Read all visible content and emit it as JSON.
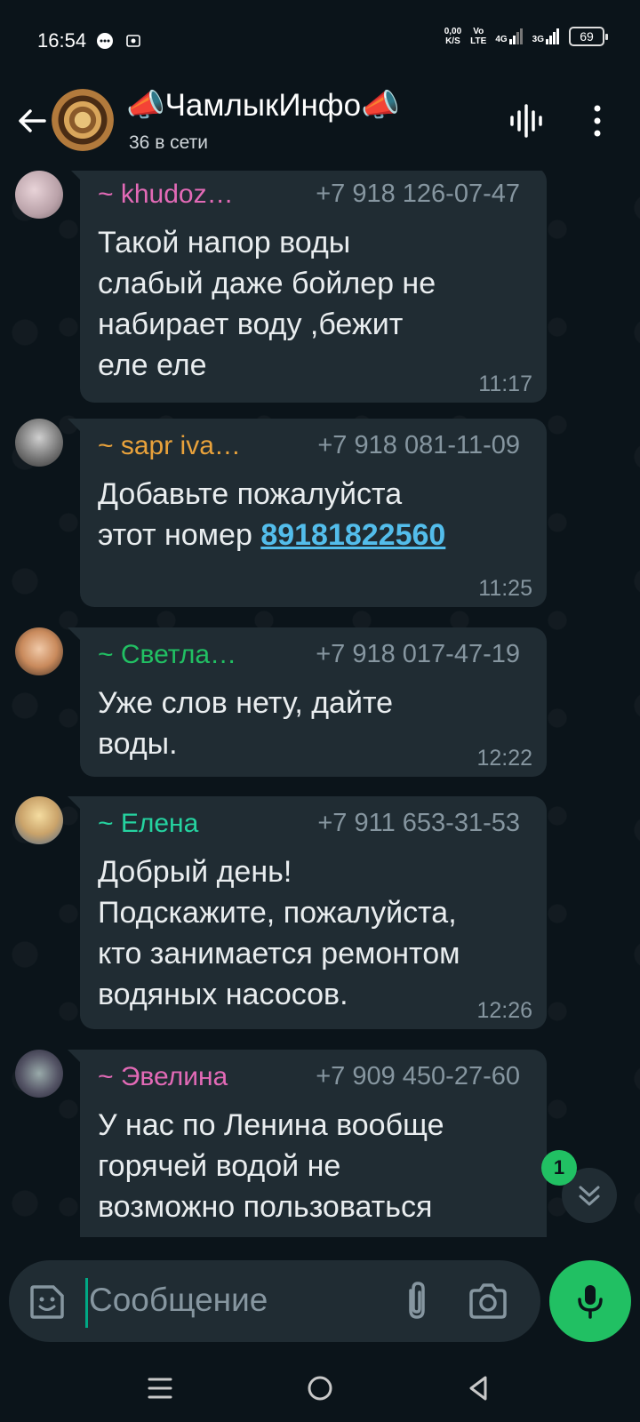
{
  "status_bar": {
    "time": "16:54",
    "net_speed_top": "0,00",
    "net_speed_bottom": "K/S",
    "volte_top": "Vo",
    "volte_bottom": "LTE",
    "net1": "4G",
    "net2": "3G",
    "battery": "69"
  },
  "header": {
    "title": "📣ЧамлыкИнфо📣",
    "subtitle": "36 в сети"
  },
  "messages": [
    {
      "sender": "~ khudoz…",
      "sender_color": "#e26ab6",
      "phone": "+7 918 126-07-47",
      "text": "Такой напор воды\nслабый  даже бойлер не\nнабирает  воду  ,бежит\nеле еле",
      "time": "11:17"
    },
    {
      "sender": "~ sapr iva…",
      "sender_color": "#e9a23b",
      "phone": "+7 918 081-11-09",
      "text_prefix": "Добавьте пожалуйста\nэтот номер ",
      "link": "89181822560",
      "time": "11:25"
    },
    {
      "sender": "~ Светла…",
      "sender_color": "#21c063",
      "phone": "+7 918 017-47-19",
      "text": "Уже слов нету, дайте\nводы.",
      "time": "12:22"
    },
    {
      "sender": "~ Елена",
      "sender_color": "#25d3a0",
      "phone": "+7 911 653-31-53",
      "text": "Добрый день!\nПодскажите, пожалуйста,\nкто занимается ремонтом\nводяных насосов.",
      "time": "12:26"
    },
    {
      "sender": "~ Эвелина",
      "sender_color": "#e26ab6",
      "phone": "+7 909 450-27-60",
      "text": "У нас по Ленина вообще\nгорячей водой не\nвозможно пользоваться",
      "time": ""
    }
  ],
  "scroll": {
    "unread_count": "1"
  },
  "composer": {
    "placeholder": "Сообщение"
  },
  "icons": [
    "back-arrow-icon",
    "voice-chat-icon",
    "more-vert-icon",
    "sticker-icon",
    "attach-icon",
    "camera-icon",
    "mic-icon",
    "chevron-double-down-icon",
    "nav-menu-icon",
    "nav-home-icon",
    "nav-back-icon"
  ],
  "colors": {
    "accent": "#21c063",
    "bubble": "#202c33",
    "background": "#0b141a",
    "link": "#53bdeb"
  }
}
